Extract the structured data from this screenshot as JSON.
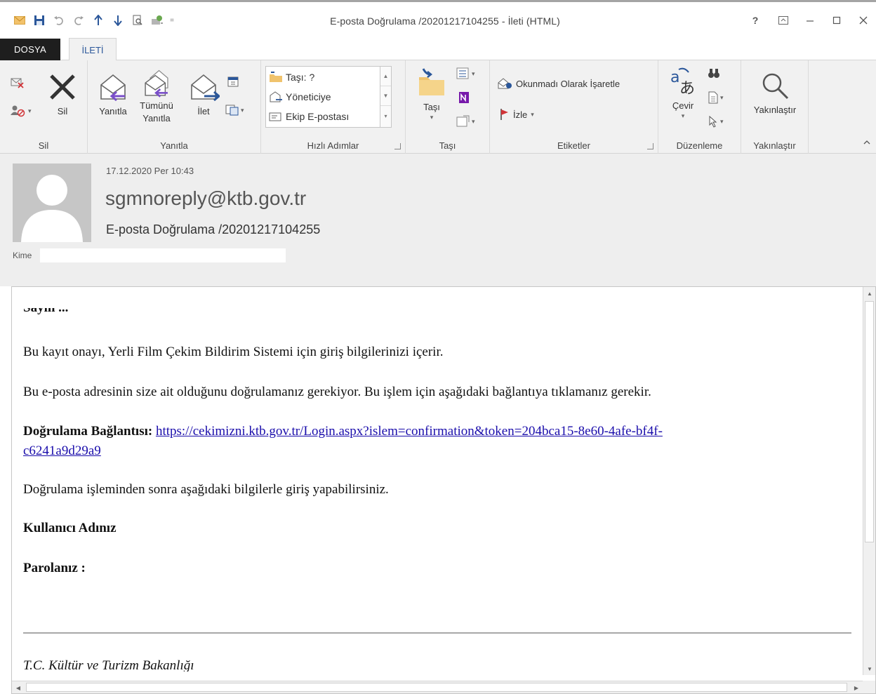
{
  "window": {
    "title": "E-posta Doğrulama /20201217104255 - İleti (HTML)",
    "help": "?",
    "colors": {
      "accent": "#2b579a",
      "file_tab": "#1e1e1e",
      "ribbon_bg": "#f1f1f1",
      "header_bg": "#eeeeee",
      "link": "#1a0dab",
      "flag": "#d13438"
    }
  },
  "tabs": {
    "file": "DOSYA",
    "message": "İLETİ"
  },
  "ribbon": {
    "sil": {
      "label": "Sil",
      "delete": "Sil"
    },
    "yanitla": {
      "label": "Yanıtla",
      "reply": "Yanıtla",
      "reply_all_1": "Tümünü",
      "reply_all_2": "Yanıtla",
      "forward": "İlet"
    },
    "hizli": {
      "label": "Hızlı Adımlar",
      "items": [
        "Taşı: ?",
        "Yöneticiye",
        "Ekip E-postası"
      ]
    },
    "tasi": {
      "label": "Taşı",
      "move": "Taşı"
    },
    "etiketler": {
      "label": "Etiketler",
      "unread": "Okunmadı Olarak İşaretle",
      "follow": "İzle"
    },
    "duzenleme": {
      "label": "Düzenleme",
      "translate": "Çevir"
    },
    "yakinlastir": {
      "label": "Yakınlaştır",
      "zoom": "Yakınlaştır"
    }
  },
  "message": {
    "date": "17.12.2020 Per 10:43",
    "from": "sgmnoreply@ktb.gov.tr",
    "subject": "E-posta Doğrulama /20201217104255",
    "to_label": "Kime",
    "body": {
      "greeting_cut": "Sayın ...",
      "line1": "Bu kayıt onayı, Yerli Film Çekim Bildirim Sistemi için giriş bilgilerinizi içerir.",
      "line2": "Bu e-posta adresinin size ait olduğunu doğrulamanız gerekiyor. Bu işlem için aşağıdaki bağlantıya tıklamanız gerekir.",
      "link_label": "Doğrulama Bağlantısı:",
      "link_part1": "https://cekimizni.ktb.gov.tr/Login.aspx?islem=confirmation&token=204bca15-8e60-4afe-bf4f-",
      "link_part2": "c6241a9d29a9",
      "line3": "Doğrulama işleminden sonra aşağıdaki bilgilerle giriş yapabilirsiniz.",
      "username_label": "Kullanıcı Adınız",
      "password_label": "Parolanız :",
      "footer": "T.C. Kültür ve Turizm Bakanlığı"
    }
  }
}
